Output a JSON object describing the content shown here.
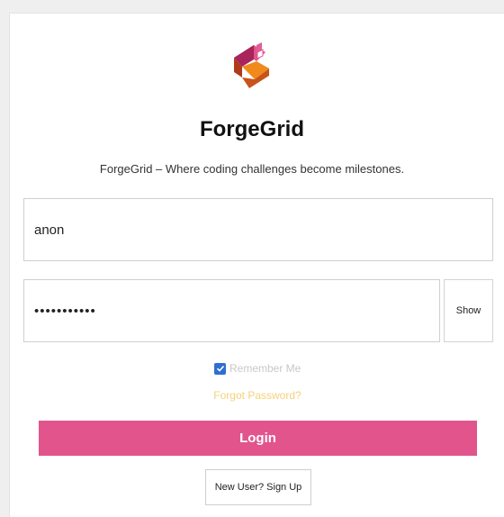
{
  "brand": {
    "logo_icon": "forgegrid-logo-icon",
    "name": "ForgeGrid",
    "tagline": "ForgeGrid – Where coding challenges become milestones."
  },
  "form": {
    "username_value": "anon",
    "password_value": "•••••••••••",
    "show_label": "Show",
    "remember_checked": true,
    "remember_label": "Remember Me",
    "forgot_label": "Forgot Password?",
    "login_label": "Login",
    "signup_label": "New User? Sign Up"
  },
  "colors": {
    "accent": "#e2548c",
    "checkbox": "#2f6fd1",
    "forgot_link": "#f3d27a"
  }
}
